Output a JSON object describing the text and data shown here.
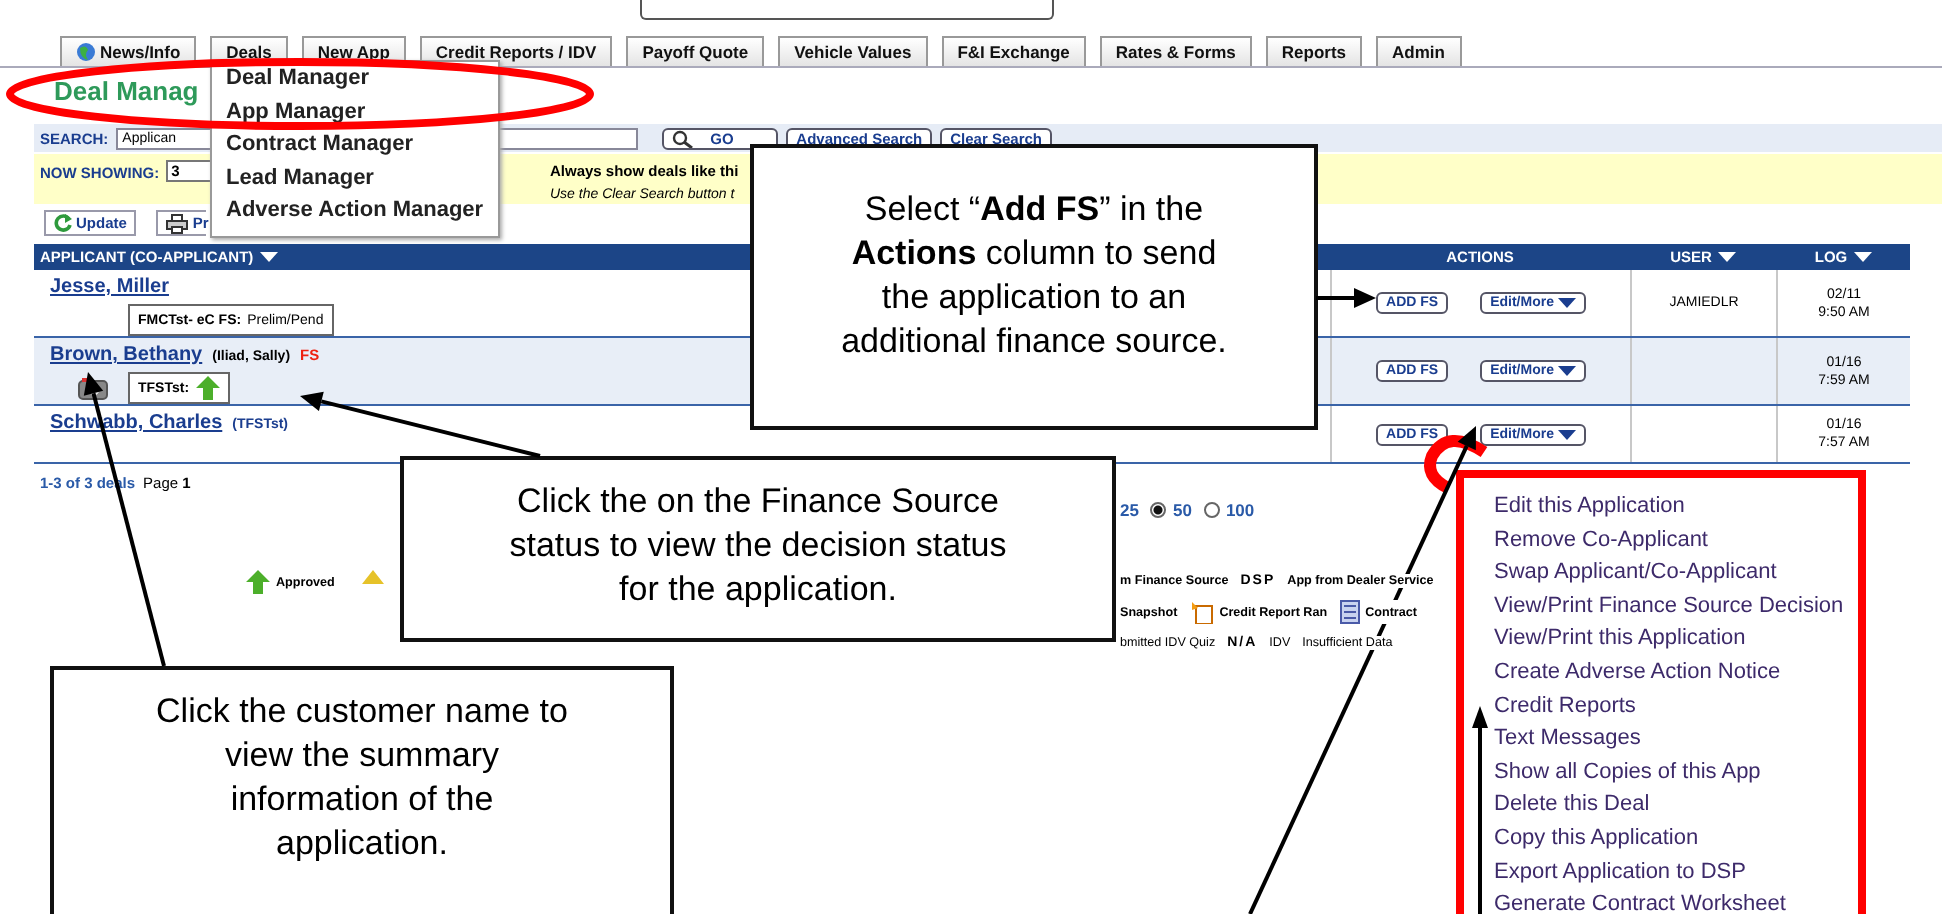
{
  "tabs": [
    {
      "label": "News/Info",
      "kind": "globe"
    },
    {
      "label": "Deals",
      "kind": "plain"
    },
    {
      "label": "New App",
      "kind": "plain"
    },
    {
      "label": "Credit Reports / IDV",
      "kind": "plain"
    },
    {
      "label": "Payoff Quote",
      "kind": "plain"
    },
    {
      "label": "Vehicle Values",
      "kind": "plain"
    },
    {
      "label": "F&I Exchange",
      "kind": "plain"
    },
    {
      "label": "Rates & Forms",
      "kind": "plain"
    },
    {
      "label": "Reports",
      "kind": "plain"
    },
    {
      "label": "Admin",
      "kind": "plain"
    }
  ],
  "deals_menu": [
    "Deal Manager",
    "App Manager",
    "Contract Manager",
    "Lead Manager",
    "Adverse Action Manager"
  ],
  "page_title": "Deal Manag",
  "search": {
    "label": "SEARCH:",
    "value": "Applican",
    "buttons": [
      {
        "label": "GO",
        "kind": "search"
      },
      {
        "label": "Advanced Search",
        "kind": "plain"
      },
      {
        "label": "Clear Search",
        "kind": "plain"
      }
    ]
  },
  "now_showing": {
    "label": "NOW SHOWING:",
    "value": "3",
    "notice": "Always show deals like thi",
    "hint": "Use the Clear Search button t"
  },
  "toolbar": [
    {
      "label": "Update",
      "kind": "refresh"
    },
    {
      "label": "Pr",
      "kind": "print"
    }
  ],
  "table": {
    "columns": [
      "APPLICANT (CO-APPLICANT)",
      "ACTIONS",
      "USER",
      "LOG"
    ],
    "rows": [
      {
        "name": "Jesse, Miller",
        "kind": "text",
        "fs_label": "FMCTst- eC FS:",
        "fs_value": "Prelim/Pend",
        "camera": false,
        "actions": [
          "ADD FS",
          "Edit/More"
        ],
        "user": "JAMIEDLR",
        "log": [
          "02/11",
          "9:50 AM"
        ]
      },
      {
        "name": "Brown, Bethany",
        "co_applicant": "(Iliad, Sally)",
        "flag": "FS",
        "kind": "approved",
        "fs_label": "TFSTst:",
        "camera": true,
        "actions": [
          "ADD FS",
          "Edit/More"
        ],
        "log": [
          "01/16",
          "7:59 AM"
        ]
      },
      {
        "name": "Schwabb, Charles",
        "co_applicant": "(TFSTst)",
        "kind": "none",
        "camera": false,
        "actions": [
          "ADD FS",
          "Edit/More"
        ],
        "log": [
          "01/16",
          "7:57 AM"
        ]
      }
    ]
  },
  "footer": {
    "count": "1-3 of 3 deals",
    "page": "Page **1**",
    "per_page": [
      {
        "label": "25"
      },
      {
        "label": "50",
        "selected": true
      },
      {
        "label": "100",
        "selected": false
      }
    ]
  },
  "legend": {
    "left": [
      {
        "kind": "approved",
        "text": "Approved"
      },
      {
        "kind": "caution"
      }
    ],
    "rows": [
      [
        {
          "kind": "text",
          "text": "m Finance Source"
        },
        {
          "kind": "code",
          "text": "DSP"
        },
        {
          "kind": "text",
          "text": "App from Dealer Service"
        }
      ],
      [
        {
          "kind": "text",
          "text": "Snapshot"
        },
        {
          "kind": "report",
          "text": "Credit Report Ran"
        },
        {
          "kind": "contract",
          "text": "Contract"
        }
      ],
      [
        {
          "kind": "text",
          "text": "bmitted IDV Quiz"
        },
        {
          "kind": "code",
          "text": "N/A"
        },
        {
          "kind": "text",
          "text": "IDV"
        },
        {
          "kind": "text",
          "text": "Insufficient Data"
        }
      ]
    ]
  },
  "action_menu": [
    "Edit this Application",
    "Remove Co-Applicant",
    "Swap Applicant/Co-Applicant",
    "View/Print Finance Source Decision",
    "View/Print this Application",
    "Create Adverse Action Notice",
    "Credit Reports",
    "Text Messages",
    "Show all Copies of this App",
    "Delete this Deal",
    "Copy this Application",
    "Export Application to DSP",
    "Generate Contract Worksheet"
  ],
  "callouts": [
    {
      "lines": [
        "Select “**Add FS**” in the",
        "**Actions** column to send",
        "the application to an",
        "additional finance source."
      ]
    },
    {
      "lines": [
        "Click the on the Finance Source",
        "status to view the decision status",
        "for the application."
      ]
    },
    {
      "lines": [
        "Click the customer name to",
        "view the summary",
        "information of the",
        "application."
      ]
    }
  ]
}
